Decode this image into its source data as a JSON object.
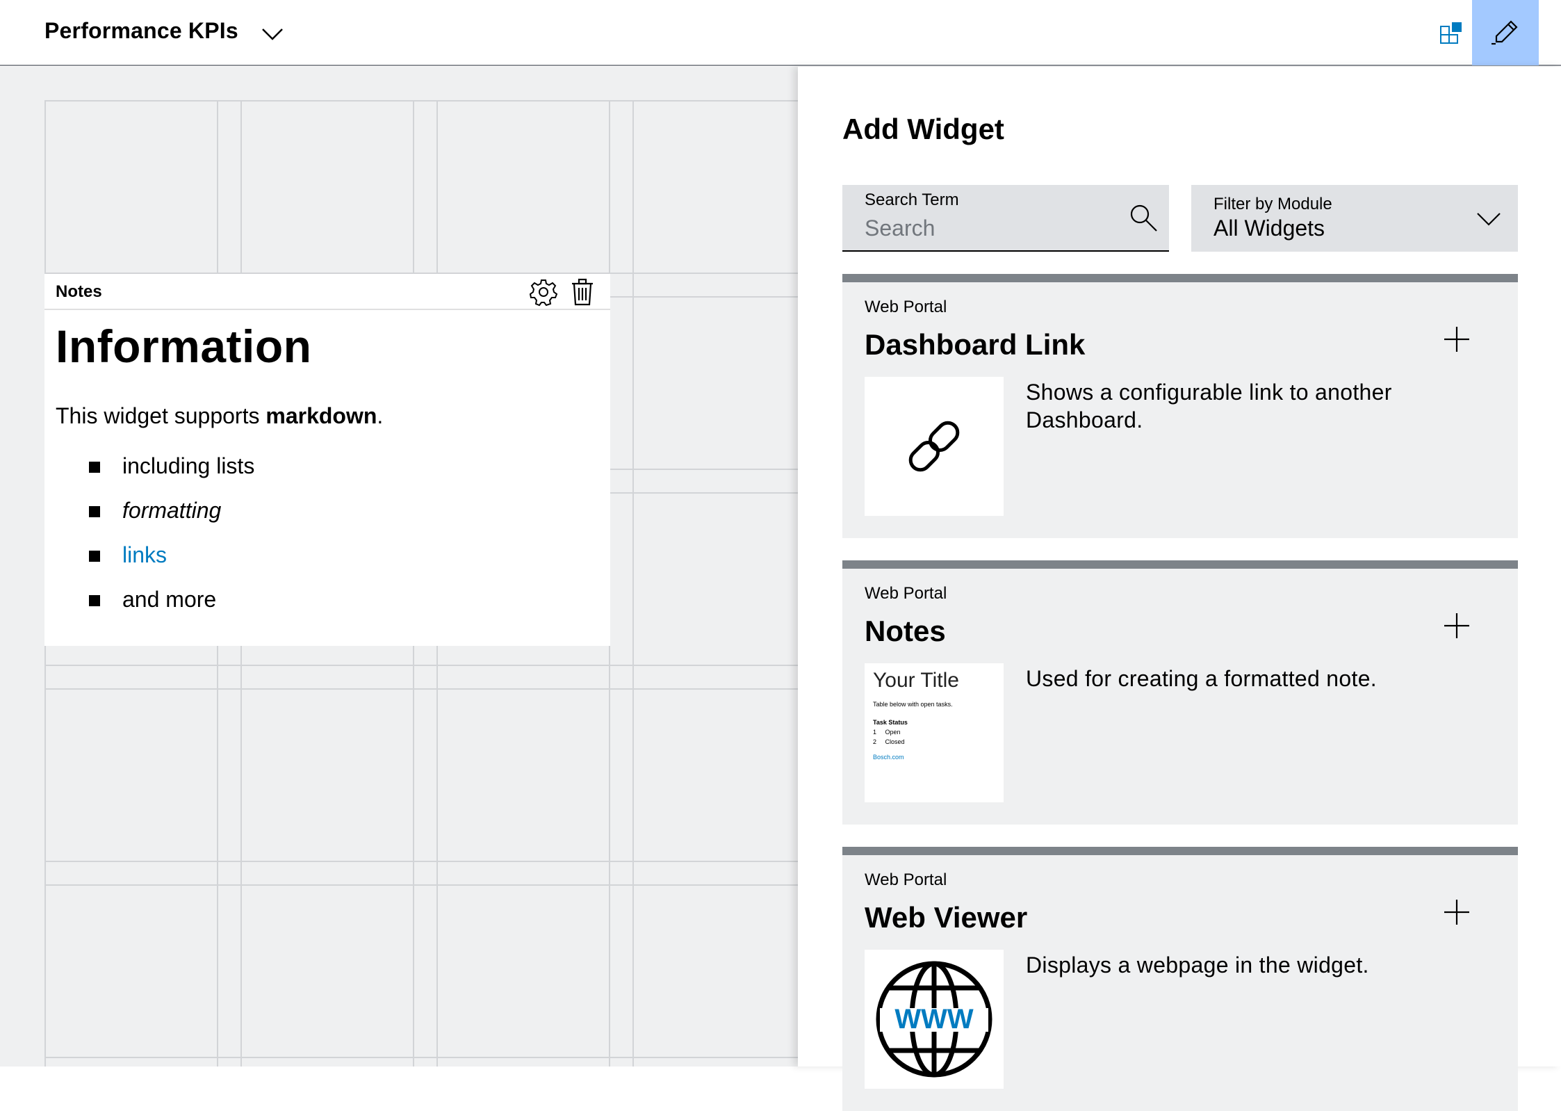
{
  "header": {
    "title": "Performance KPIs",
    "accent_color": "#a3c9ff",
    "icons": [
      "chevron-down-icon",
      "dashboard-layout-icon",
      "pencil-icon"
    ]
  },
  "note_widget": {
    "header_label": "Notes",
    "heading": "Information",
    "intro_prefix": "This widget supports ",
    "intro_bold": "markdown",
    "intro_suffix": ".",
    "list_items": [
      "including lists",
      "formatting",
      "links",
      "and more"
    ],
    "link_color": "#007bc0",
    "icons": [
      "gear-icon",
      "trash-icon"
    ]
  },
  "panel": {
    "title": "Add Widget",
    "search": {
      "label": "Search Term",
      "placeholder": "Search",
      "value": ""
    },
    "filter": {
      "label": "Filter by Module",
      "value": "All Widgets"
    },
    "cards": [
      {
        "module": "Web Portal",
        "name": "Dashboard Link",
        "description": "Shows a configurable link to another Dashboard.",
        "icon": "link-icon"
      },
      {
        "module": "Web Portal",
        "name": "Notes",
        "description": "Used for creating a formatted note.",
        "preview": {
          "title": "Your Title",
          "subtitle": "Table below with open tasks.",
          "table_header": "Task Status",
          "rows": [
            "1     Open",
            "2     Closed"
          ],
          "link": "Bosch.com"
        }
      },
      {
        "module": "Web Portal",
        "name": "Web Viewer",
        "description": "Displays a webpage in the widget.",
        "icon": "globe-www-icon",
        "icon_text": "WWW"
      }
    ]
  }
}
